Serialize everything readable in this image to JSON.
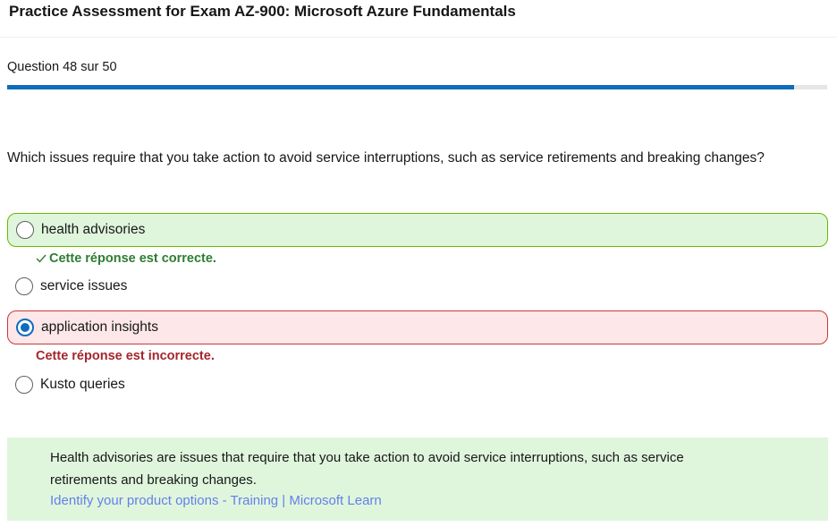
{
  "header": {
    "title": "Practice Assessment for Exam AZ-900: Microsoft Azure Fundamentals"
  },
  "progress": {
    "label": "Question 48 sur 50",
    "fraction": 0.96
  },
  "question": {
    "text": "Which issues require that you take action to avoid service interruptions, such as service retirements and breaking changes?"
  },
  "options": [
    {
      "label": "health advisories",
      "state": "correct",
      "selected": false
    },
    {
      "label": "service issues",
      "state": "neutral",
      "selected": false
    },
    {
      "label": "application insights",
      "state": "incorrect",
      "selected": true
    },
    {
      "label": "Kusto queries",
      "state": "neutral",
      "selected": false
    }
  ],
  "feedback": {
    "correct": "Cette réponse est correcte.",
    "incorrect": "Cette réponse est incorrecte."
  },
  "explanation": {
    "text": "Health advisories are issues that require that you take action to avoid service interruptions, such as service retirements and breaking changes.",
    "link": "Identify your product options - Training | Microsoft Learn"
  },
  "colors": {
    "accent": "#0f6cbd",
    "correct_bg": "#dff6dd",
    "incorrect_bg": "#fde7e9",
    "correct_text": "#2e7d32",
    "incorrect_text": "#a4262c"
  }
}
